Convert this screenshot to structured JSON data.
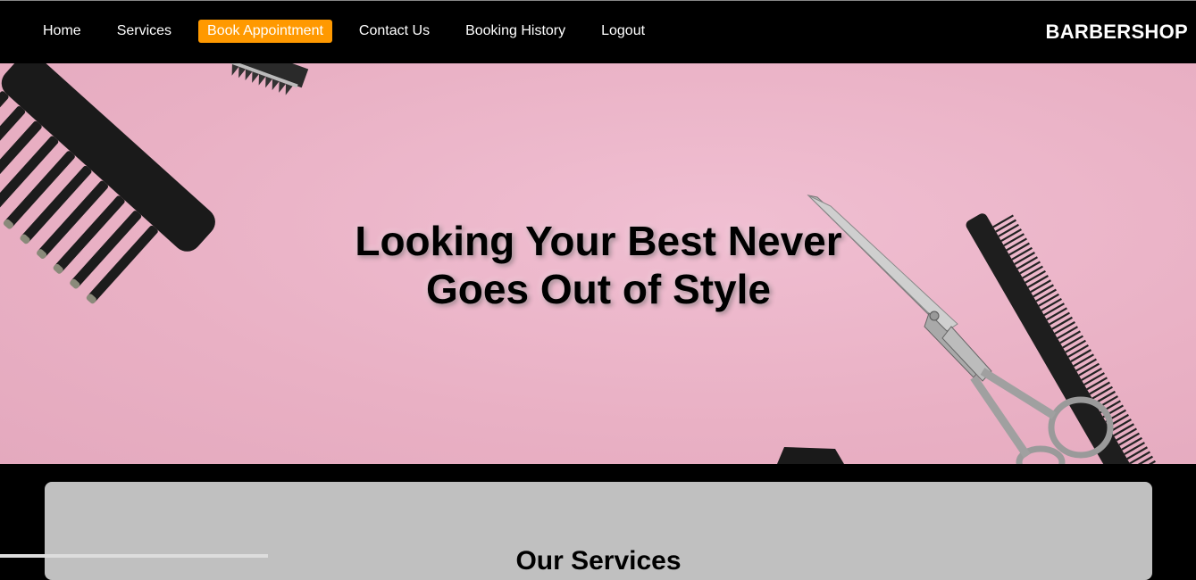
{
  "nav": {
    "items": [
      {
        "label": "Home",
        "active": false
      },
      {
        "label": "Services",
        "active": false
      },
      {
        "label": "Book Appointment",
        "active": true
      },
      {
        "label": "Contact Us",
        "active": false
      },
      {
        "label": "Booking History",
        "active": false
      },
      {
        "label": "Logout",
        "active": false
      }
    ],
    "brand": "BARBERSHOP",
    "active_color": "#ff9900"
  },
  "hero": {
    "title_line1": "Looking Your Best Never",
    "title_line2": "Goes Out of Style",
    "background_color": "#eeb9cc"
  },
  "services": {
    "title": "Our Services"
  }
}
